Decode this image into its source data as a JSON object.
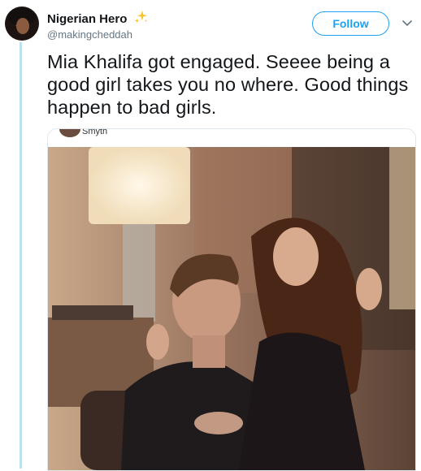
{
  "tweet": {
    "author": {
      "display_name": "Nigerian Hero",
      "handle": "@makingcheddah"
    },
    "follow_label": "Follow",
    "text": "Mia Khalifa got engaged. Seeee being a good girl takes you no where. Good things happen to bad girls.",
    "media": {
      "caption_fragment": "Smyth"
    }
  },
  "icons": {
    "badge": "sparkles-icon",
    "menu": "chevron-down-icon"
  },
  "colors": {
    "accent": "#1da1f2",
    "thread_line": "#bfe0f2",
    "handle_gray": "#657786"
  }
}
